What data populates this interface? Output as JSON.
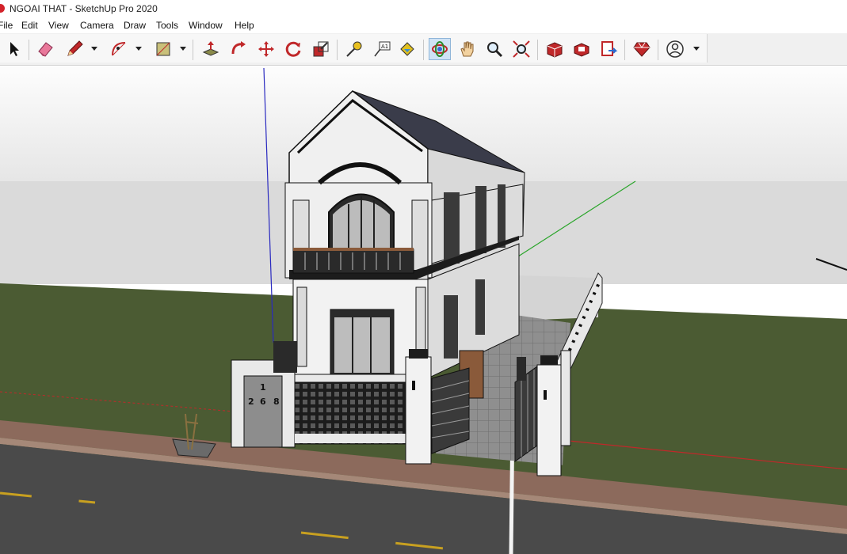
{
  "window": {
    "title": "NGOAI THAT - SketchUp Pro 2020"
  },
  "menu": [
    "File",
    "Edit",
    "View",
    "Camera",
    "Draw",
    "Tools",
    "Window",
    "Help"
  ],
  "toolbar": {
    "tools": [
      {
        "name": "select-tool",
        "icon": "arrow-cursor-icon"
      },
      {
        "name": "eraser-tool",
        "icon": "eraser-icon"
      },
      {
        "name": "line-tool",
        "icon": "pencil-icon"
      },
      {
        "name": "arc-tool",
        "icon": "arc-icon"
      },
      {
        "name": "rectangle-tool",
        "icon": "rectangle-icon"
      },
      {
        "name": "push-pull-tool",
        "icon": "push-pull-icon"
      },
      {
        "name": "follow-me-tool",
        "icon": "follow-me-icon"
      },
      {
        "name": "move-tool",
        "icon": "move-icon"
      },
      {
        "name": "rotate-tool",
        "icon": "rotate-icon"
      },
      {
        "name": "scale-tool",
        "icon": "scale-icon"
      },
      {
        "name": "tape-measure-tool",
        "icon": "tape-measure-icon"
      },
      {
        "name": "text-tool",
        "icon": "text-icon"
      },
      {
        "name": "paint-bucket-tool",
        "icon": "paint-bucket-icon"
      },
      {
        "name": "orbit-tool",
        "icon": "orbit-icon",
        "active": true
      },
      {
        "name": "pan-tool",
        "icon": "hand-icon"
      },
      {
        "name": "zoom-tool",
        "icon": "magnifier-icon"
      },
      {
        "name": "zoom-extents-tool",
        "icon": "zoom-extents-icon"
      },
      {
        "name": "3d-warehouse-button",
        "icon": "warehouse-icon"
      },
      {
        "name": "extension-warehouse-button",
        "icon": "extension-warehouse-icon"
      },
      {
        "name": "send-to-layout-button",
        "icon": "layout-icon"
      },
      {
        "name": "extension-manager-button",
        "icon": "ruby-icon"
      },
      {
        "name": "account-button",
        "icon": "user-icon"
      }
    ]
  },
  "scene": {
    "house_number": [
      "1",
      "2",
      "6",
      "8"
    ],
    "colors": {
      "sky": "#fcfcfc",
      "horizon": "#dcdcdc",
      "grass": "#4a5a32",
      "road": "#4a4a4a",
      "sidewalk": "#8c6a5c",
      "wall": "#efefef",
      "trim": "#1a1a1a",
      "roof": "#3a3c4a",
      "axis_red": "#c0282a",
      "axis_green": "#2aa52a",
      "axis_blue": "#2a2ac0"
    }
  }
}
